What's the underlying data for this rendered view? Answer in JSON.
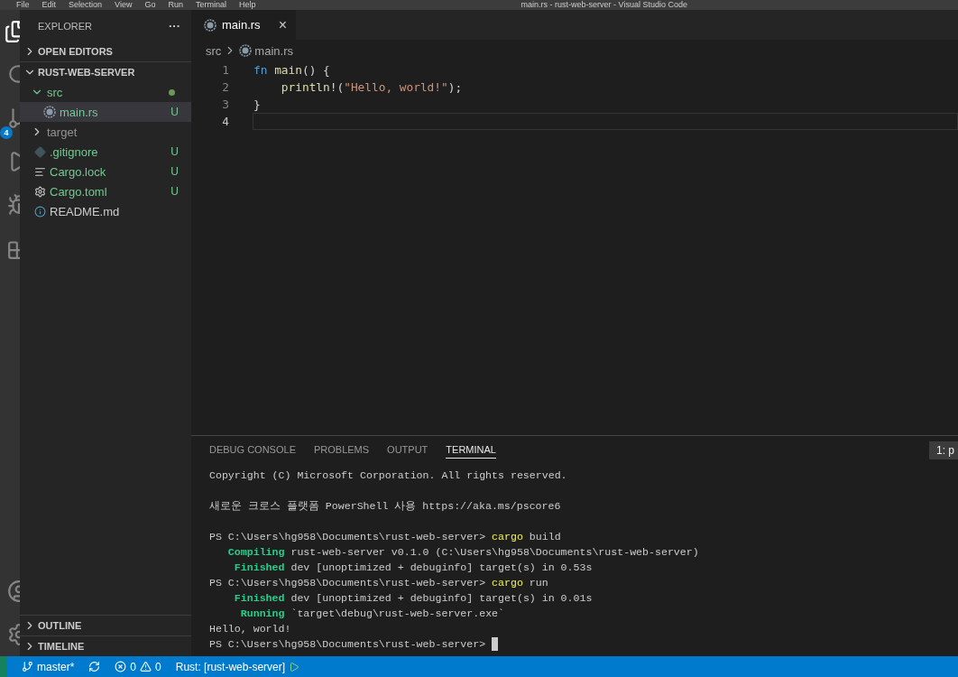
{
  "menu_bar": {
    "items": [
      "File",
      "Edit",
      "Selection",
      "View",
      "Go",
      "Run",
      "Terminal",
      "Help"
    ],
    "title": "main.rs - rust-web-server - Visual Studio Code"
  },
  "activity_bar": {
    "source_control_badge": "4"
  },
  "sidebar": {
    "title": "EXPLORER",
    "more": "···",
    "sections_top": [
      {
        "label": "OPEN EDITORS",
        "expanded": false
      },
      {
        "label": "RUST-WEB-SERVER",
        "expanded": true
      }
    ],
    "tree": [
      {
        "label": "src",
        "kind": "folder",
        "expanded": true,
        "untracked": true,
        "ignored": false,
        "dot": true,
        "selected": false,
        "children": [
          {
            "label": "main.rs",
            "kind": "rust",
            "untracked": true,
            "ignored": false,
            "badge": "U",
            "selected": true
          }
        ]
      },
      {
        "label": "target",
        "kind": "folder",
        "expanded": false,
        "untracked": false,
        "ignored": true,
        "dot": false,
        "selected": false
      },
      {
        "label": ".gitignore",
        "kind": "git",
        "untracked": true,
        "ignored": false,
        "badge": "U",
        "selected": false
      },
      {
        "label": "Cargo.lock",
        "kind": "lines",
        "untracked": true,
        "ignored": false,
        "badge": "U",
        "selected": false
      },
      {
        "label": "Cargo.toml",
        "kind": "gear",
        "untracked": true,
        "ignored": false,
        "badge": "U",
        "selected": false
      },
      {
        "label": "README.md",
        "kind": "info",
        "untracked": false,
        "ignored": false,
        "selected": false
      }
    ],
    "sections_bottom": [
      {
        "label": "OUTLINE",
        "expanded": false
      },
      {
        "label": "TIMELINE",
        "expanded": false
      }
    ]
  },
  "tabs": [
    {
      "label": "main.rs",
      "close": "×",
      "selected": true
    }
  ],
  "breadcrumb": [
    "src",
    "main.rs"
  ],
  "code": [
    {
      "number": "1",
      "current": false,
      "tokens": [
        {
          "kind": "keyword",
          "text": "fn"
        },
        {
          "kind": "function",
          "text": " main"
        },
        {
          "kind": "plain",
          "text": "() {"
        }
      ]
    },
    {
      "number": "2",
      "current": false,
      "tokens": [
        {
          "kind": "function",
          "text": "    println!"
        },
        {
          "kind": "plain",
          "text": "("
        },
        {
          "kind": "string",
          "text": "\"Hello, world!\""
        },
        {
          "kind": "plain",
          "text": ");"
        }
      ]
    },
    {
      "number": "3",
      "current": false,
      "tokens": [
        {
          "kind": "plain",
          "text": "}"
        }
      ]
    },
    {
      "number": "4",
      "current": true
    }
  ],
  "panel": {
    "tabs": [
      {
        "label": "DEBUG CONSOLE",
        "selected": false
      },
      {
        "label": "PROBLEMS",
        "selected": false
      },
      {
        "label": "OUTPUT",
        "selected": false
      },
      {
        "label": "TERMINAL",
        "selected": true
      }
    ],
    "terminal_picker": "1: p",
    "lines": [
      {
        "gap_after": true,
        "segments": [
          {
            "kind": "plain",
            "text": "Copyright (C) Microsoft Corporation. All rights reserved."
          }
        ]
      },
      {
        "gap_after": true,
        "segments": [
          {
            "kind": "plain",
            "text": "새로운 크로스 플랫폼 PowerShell 사용 https://aka.ms/pscore6"
          }
        ]
      },
      {
        "gap_after": false,
        "segments": [
          {
            "kind": "plain",
            "text": "PS C:\\Users\\hg958\\Documents\\rust-web-server> "
          },
          {
            "kind": "command",
            "text": "cargo"
          },
          {
            "kind": "plain",
            "text": " build"
          }
        ]
      },
      {
        "gap_after": false,
        "segments": [
          {
            "kind": "status",
            "text": "   Compiling"
          },
          {
            "kind": "plain",
            "text": " rust-web-server v0.1.0 (C:\\Users\\hg958\\Documents\\rust-web-server)"
          }
        ]
      },
      {
        "gap_after": false,
        "segments": [
          {
            "kind": "status",
            "text": "    Finished"
          },
          {
            "kind": "plain",
            "text": " dev [unoptimized + debuginfo] target(s) in 0.53s"
          }
        ]
      },
      {
        "gap_after": false,
        "segments": [
          {
            "kind": "plain",
            "text": "PS C:\\Users\\hg958\\Documents\\rust-web-server> "
          },
          {
            "kind": "command",
            "text": "cargo"
          },
          {
            "kind": "plain",
            "text": " run"
          }
        ]
      },
      {
        "gap_after": false,
        "segments": [
          {
            "kind": "status",
            "text": "    Finished"
          },
          {
            "kind": "plain",
            "text": " dev [unoptimized + debuginfo] target(s) in 0.01s"
          }
        ]
      },
      {
        "gap_after": false,
        "segments": [
          {
            "kind": "status",
            "text": "     Running"
          },
          {
            "kind": "plain",
            "text": " `target\\debug\\rust-web-server.exe`"
          }
        ]
      },
      {
        "gap_after": false,
        "segments": [
          {
            "kind": "plain",
            "text": "Hello, world!"
          }
        ]
      },
      {
        "gap_after": false,
        "cursor": true,
        "segments": [
          {
            "kind": "plain",
            "text": "PS C:\\Users\\hg958\\Documents\\rust-web-server> "
          }
        ]
      }
    ]
  },
  "status_bar": {
    "branch": "master*",
    "errors": "0",
    "warnings": "0",
    "rust": "Rust: [rust-web-server]"
  }
}
